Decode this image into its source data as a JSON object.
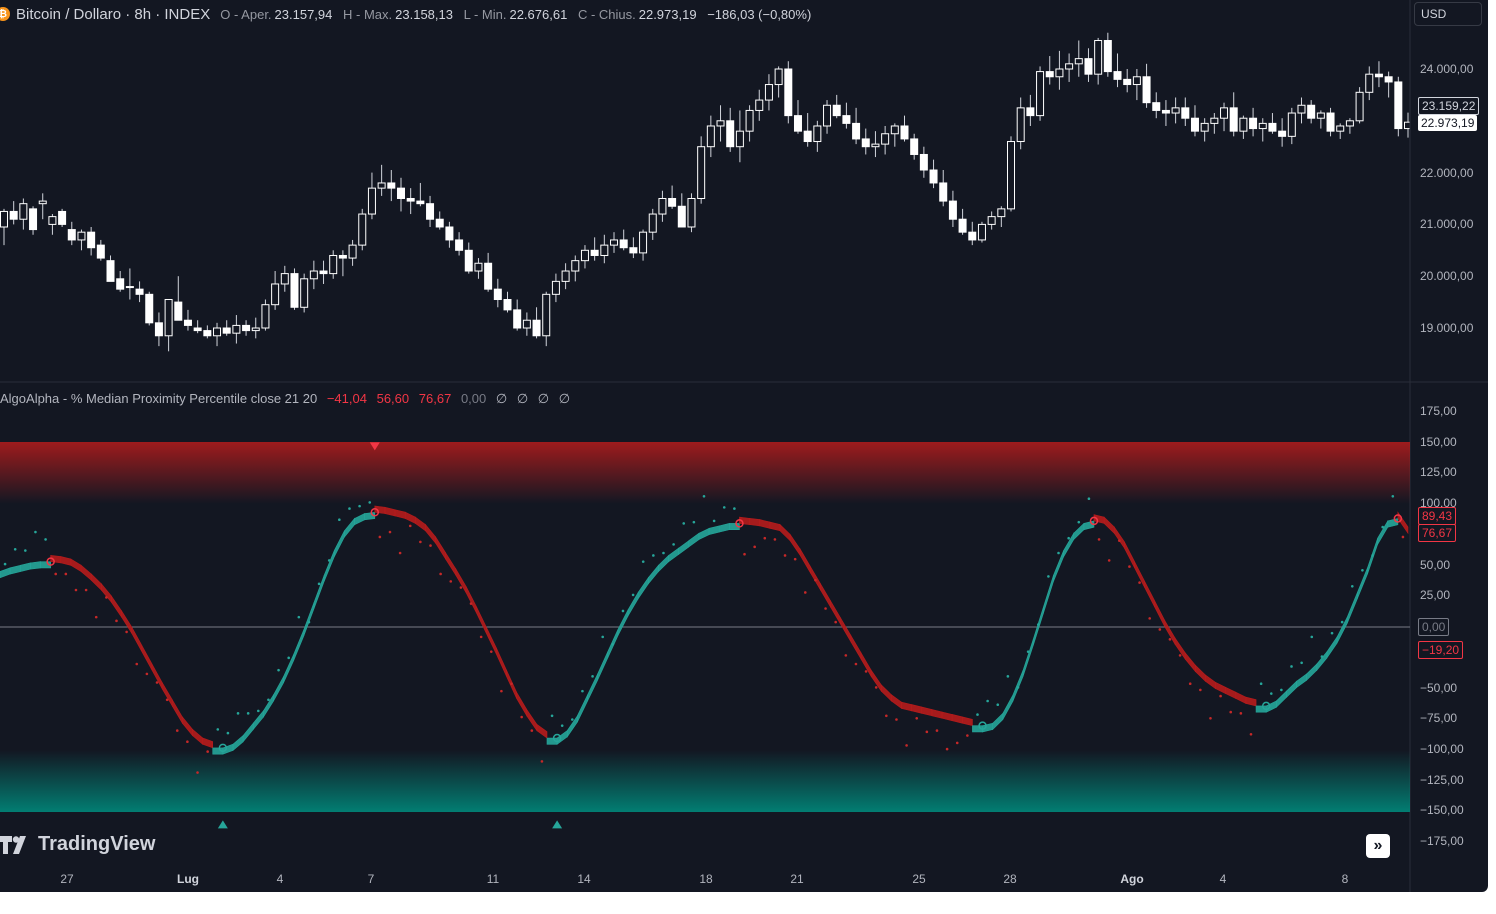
{
  "header": {
    "symbol": "Bitcoin / Dollaro · 8h · INDEX",
    "open_label": "O - Aper.",
    "open_value": "23.157,94",
    "high_label": "H - Max.",
    "high_value": "23.158,13",
    "low_label": "L - Min.",
    "low_value": "22.676,61",
    "close_label": "C - Chius.",
    "close_value": "22.973,19",
    "change": "−186,03 (−0,80%)",
    "currency": "USD"
  },
  "price_scale": {
    "ticks": [
      "24.000,00",
      "22.000,00",
      "21.000,00",
      "20.000,00",
      "19.000,00"
    ],
    "label_prev": "23.159,22",
    "label_last": "22.973,19"
  },
  "indicator": {
    "name": "AlgoAlpha - % Median Proximity Percentile close 21 20",
    "values": [
      "−41,04",
      "56,60",
      "76,67",
      "0,00"
    ],
    "na": [
      "∅",
      "∅",
      "∅",
      "∅"
    ],
    "scale_ticks": [
      "175,00",
      "150,00",
      "125,00",
      "100,00",
      "50,00",
      "25,00",
      "−50,00",
      "−75,00",
      "−100,00",
      "−125,00",
      "−150,00",
      "−175,00"
    ],
    "label_89": "89,43",
    "label_76": "76,67",
    "label_zero": "0,00",
    "label_neg": "−19,20"
  },
  "time_axis": {
    "labels": [
      "27",
      "Lug",
      "4",
      "7",
      "11",
      "14",
      "18",
      "21",
      "25",
      "28",
      "Ago",
      "4",
      "8"
    ]
  },
  "branding": {
    "logo_text": "TradingView"
  },
  "colors": {
    "bull": "#26a69a",
    "bear": "#b71c1c",
    "background": "#131722"
  },
  "chart_data": {
    "type": "candlestick",
    "candles_ohlc": [
      [
        20950,
        21300,
        20600,
        21250
      ],
      [
        21250,
        21450,
        21000,
        21100
      ],
      [
        21100,
        21500,
        20900,
        21400
      ],
      [
        21300,
        21350,
        20800,
        20900
      ],
      [
        21400,
        21600,
        21100,
        21450
      ],
      [
        21000,
        21200,
        20800,
        21150
      ],
      [
        21250,
        21300,
        20950,
        21000
      ],
      [
        20900,
        21050,
        20600,
        20700
      ],
      [
        20700,
        20900,
        20500,
        20850
      ],
      [
        20850,
        20950,
        20400,
        20550
      ],
      [
        20600,
        20700,
        20300,
        20350
      ],
      [
        20300,
        20400,
        19950,
        19900
      ],
      [
        19950,
        20100,
        19700,
        19750
      ],
      [
        19800,
        20150,
        19550,
        19800
      ],
      [
        19750,
        19900,
        19500,
        19650
      ],
      [
        19650,
        19700,
        19050,
        19100
      ],
      [
        19100,
        19300,
        18650,
        18850
      ],
      [
        18850,
        19450,
        18550,
        19550
      ],
      [
        19500,
        20000,
        19200,
        19150
      ],
      [
        19150,
        19350,
        18950,
        19050
      ],
      [
        19000,
        19150,
        18900,
        18950
      ],
      [
        18950,
        19050,
        18800,
        18850
      ],
      [
        18850,
        19100,
        18650,
        19000
      ],
      [
        19000,
        19150,
        18850,
        18900
      ],
      [
        18900,
        19250,
        18700,
        19050
      ],
      [
        19050,
        19150,
        18850,
        18950
      ],
      [
        18950,
        19200,
        18800,
        19000
      ],
      [
        19000,
        19550,
        18950,
        19450
      ],
      [
        19450,
        20100,
        19350,
        19850
      ],
      [
        19850,
        20200,
        19700,
        20050
      ],
      [
        20050,
        20150,
        19350,
        19400
      ],
      [
        19400,
        20050,
        19300,
        19950
      ],
      [
        19950,
        20300,
        19750,
        20100
      ],
      [
        20100,
        20300,
        19850,
        20050
      ],
      [
        20050,
        20500,
        19950,
        20400
      ],
      [
        20400,
        20500,
        20000,
        20350
      ],
      [
        20350,
        20700,
        20200,
        20600
      ],
      [
        20600,
        21300,
        20500,
        21200
      ],
      [
        21200,
        22000,
        21100,
        21700
      ],
      [
        21700,
        22150,
        21550,
        21800
      ],
      [
        21800,
        22050,
        21450,
        21700
      ],
      [
        21700,
        21900,
        21250,
        21500
      ],
      [
        21500,
        21700,
        21200,
        21450
      ],
      [
        21450,
        21800,
        21350,
        21400
      ],
      [
        21400,
        21550,
        20950,
        21100
      ],
      [
        21100,
        21250,
        20900,
        20950
      ],
      [
        20950,
        21050,
        20550,
        20700
      ],
      [
        20700,
        20850,
        20400,
        20500
      ],
      [
        20500,
        20650,
        20050,
        20100
      ],
      [
        20100,
        20350,
        19950,
        20250
      ],
      [
        20250,
        20450,
        19700,
        19750
      ],
      [
        19750,
        19950,
        19400,
        19550
      ],
      [
        19550,
        19700,
        19300,
        19350
      ],
      [
        19350,
        19550,
        18950,
        19000
      ],
      [
        19000,
        19300,
        18850,
        19150
      ],
      [
        19150,
        19400,
        18800,
        18850
      ],
      [
        18850,
        19700,
        18650,
        19650
      ],
      [
        19650,
        20050,
        19500,
        19900
      ],
      [
        19900,
        20250,
        19750,
        20100
      ],
      [
        20100,
        20400,
        19900,
        20300
      ],
      [
        20300,
        20600,
        20150,
        20500
      ],
      [
        20500,
        20750,
        20300,
        20400
      ],
      [
        20400,
        20800,
        20250,
        20600
      ],
      [
        20600,
        20850,
        20450,
        20700
      ],
      [
        20700,
        20900,
        20500,
        20550
      ],
      [
        20550,
        20750,
        20350,
        20450
      ],
      [
        20450,
        20900,
        20300,
        20850
      ],
      [
        20850,
        21300,
        20700,
        21200
      ],
      [
        21200,
        21650,
        21050,
        21500
      ],
      [
        21500,
        21750,
        21300,
        21350
      ],
      [
        21350,
        21600,
        21100,
        20950
      ],
      [
        20950,
        21600,
        20850,
        21500
      ],
      [
        21500,
        22700,
        21400,
        22500
      ],
      [
        22500,
        23100,
        22300,
        22900
      ],
      [
        22900,
        23300,
        22600,
        23000
      ],
      [
        23000,
        23250,
        22400,
        22500
      ],
      [
        22500,
        23200,
        22200,
        22800
      ],
      [
        22800,
        23300,
        22600,
        23200
      ],
      [
        23200,
        23600,
        23000,
        23400
      ],
      [
        23400,
        23900,
        23200,
        23700
      ],
      [
        23700,
        24050,
        23450,
        24000
      ],
      [
        24000,
        24150,
        22950,
        23100
      ],
      [
        23100,
        23400,
        22750,
        22800
      ],
      [
        22800,
        23150,
        22500,
        22600
      ],
      [
        22600,
        23000,
        22400,
        22900
      ],
      [
        22900,
        23400,
        22750,
        23300
      ],
      [
        23300,
        23500,
        23050,
        23100
      ],
      [
        23100,
        23350,
        22850,
        22950
      ],
      [
        22950,
        23250,
        22550,
        22650
      ],
      [
        22650,
        22850,
        22350,
        22500
      ],
      [
        22500,
        22800,
        22300,
        22550
      ],
      [
        22550,
        22900,
        22350,
        22750
      ],
      [
        22750,
        22950,
        22500,
        22900
      ],
      [
        22900,
        23100,
        22600,
        22650
      ],
      [
        22650,
        22750,
        22250,
        22350
      ],
      [
        22350,
        22500,
        21900,
        22050
      ],
      [
        22050,
        22250,
        21700,
        21800
      ],
      [
        21800,
        22050,
        21350,
        21450
      ],
      [
        21450,
        21650,
        20950,
        21100
      ],
      [
        21100,
        21300,
        20800,
        20850
      ],
      [
        20850,
        21050,
        20600,
        20700
      ],
      [
        20700,
        21050,
        20650,
        21000
      ],
      [
        21000,
        21250,
        20900,
        21150
      ],
      [
        21150,
        21350,
        20950,
        21300
      ],
      [
        21300,
        22700,
        21250,
        22600
      ],
      [
        22600,
        23450,
        22450,
        23250
      ],
      [
        23250,
        23500,
        22900,
        23100
      ],
      [
        23100,
        24050,
        23000,
        23950
      ],
      [
        23950,
        24250,
        23700,
        23850
      ],
      [
        23850,
        24350,
        23600,
        24000
      ],
      [
        24000,
        24300,
        23750,
        24100
      ],
      [
        24100,
        24550,
        23850,
        24200
      ],
      [
        24200,
        24400,
        23750,
        23900
      ],
      [
        23900,
        24600,
        23700,
        24550
      ],
      [
        24550,
        24700,
        23850,
        23950
      ],
      [
        23950,
        24300,
        23650,
        23800
      ],
      [
        23800,
        24000,
        23550,
        23700
      ],
      [
        23700,
        24000,
        23400,
        23850
      ],
      [
        23850,
        24100,
        23250,
        23350
      ],
      [
        23350,
        23550,
        23050,
        23200
      ],
      [
        23200,
        23400,
        22900,
        23150
      ],
      [
        23150,
        23450,
        22950,
        23250
      ],
      [
        23250,
        23450,
        22900,
        23050
      ],
      [
        23050,
        23300,
        22700,
        22800
      ],
      [
        22800,
        23050,
        22600,
        22950
      ],
      [
        22950,
        23150,
        22750,
        23050
      ],
      [
        23050,
        23350,
        22800,
        23250
      ],
      [
        23250,
        23550,
        22700,
        22800
      ],
      [
        22800,
        23100,
        22650,
        23050
      ],
      [
        23050,
        23250,
        22700,
        22850
      ],
      [
        22850,
        23050,
        22600,
        22950
      ],
      [
        22950,
        23150,
        22750,
        22800
      ],
      [
        22800,
        23050,
        22500,
        22700
      ],
      [
        22700,
        23250,
        22550,
        23150
      ],
      [
        23150,
        23450,
        22950,
        23300
      ],
      [
        23300,
        23400,
        22950,
        23050
      ],
      [
        23050,
        23200,
        22850,
        23150
      ],
      [
        23150,
        23250,
        22700,
        22800
      ],
      [
        22800,
        22950,
        22650,
        22900
      ],
      [
        22900,
        23050,
        22750,
        23000
      ],
      [
        23000,
        23650,
        22950,
        23550
      ],
      [
        23550,
        24050,
        23400,
        23900
      ],
      [
        23900,
        24150,
        23650,
        23850
      ],
      [
        23850,
        23950,
        23450,
        23750
      ],
      [
        23750,
        23850,
        22700,
        22850
      ],
      [
        22850,
        23158,
        22676,
        22973
      ]
    ],
    "indicator_series": [
      45,
      48,
      50,
      52,
      53,
      53,
      52,
      50,
      45,
      38,
      30,
      20,
      8,
      -5,
      -20,
      -35,
      -50,
      -64,
      -78,
      -88,
      -95,
      -98,
      -98,
      -95,
      -88,
      -78,
      -68,
      -55,
      -40,
      -22,
      -2,
      20,
      42,
      62,
      78,
      88,
      92,
      93,
      92,
      90,
      88,
      84,
      78,
      68,
      55,
      42,
      28,
      12,
      -5,
      -22,
      -40,
      -58,
      -72,
      -84,
      -90,
      -90,
      -84,
      -72,
      -55,
      -38,
      -20,
      -2,
      14,
      28,
      40,
      50,
      58,
      64,
      70,
      76,
      80,
      82,
      84,
      84,
      83,
      82,
      80,
      78,
      70,
      58,
      44,
      30,
      16,
      2,
      -12,
      -26,
      -40,
      -52,
      -60,
      -66,
      -68,
      -70,
      -72,
      -74,
      -76,
      -78,
      -80,
      -80,
      -78,
      -70,
      -55,
      -35,
      -10,
      16,
      42,
      62,
      76,
      84,
      86,
      84,
      76,
      64,
      48,
      32,
      16,
      0,
      -14,
      -26,
      -36,
      -44,
      -50,
      -54,
      -58,
      -62,
      -64,
      -64,
      -60,
      -52,
      -44,
      -38,
      -30,
      -20,
      -8,
      8,
      28,
      48,
      72,
      86,
      88,
      76
    ],
    "y_range_price": [
      18600,
      24700
    ],
    "y_range_indicator": [
      -175,
      175
    ]
  }
}
